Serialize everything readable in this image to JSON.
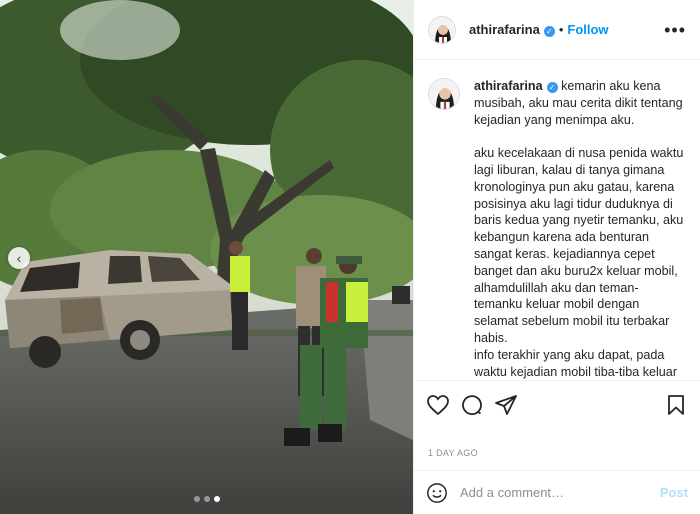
{
  "post": {
    "username": "athirafarina",
    "follow_label": "Follow",
    "bullet": "•",
    "more_label": "•••",
    "verified_mark": "✓",
    "timestamp": "1 DAY AGO",
    "carousel": {
      "count": 3,
      "active_index": 2,
      "prev_icon": "chevron-left-icon",
      "prev_glyph": "‹"
    }
  },
  "caption": {
    "username": "athirafarina",
    "paragraph1": "kemarin aku kena musibah, aku mau cerita dikit tentang kejadian yang menimpa aku.",
    "paragraph2": "aku kecelakaan di nusa penida waktu lagi liburan, kalau di tanya gimana kronologinya pun aku gatau, karena posisinya aku lagi tidur duduknya di baris kedua yang nyetir temanku, aku kebangun karena ada benturan sangat keras. kejadiannya cepet banget dan aku buru2x keluar mobil, alhamdulillah aku dan teman-temanku keluar mobil dengan selamat sebelum mobil itu terbakar habis.",
    "paragraph3": "info terakhir yang aku dapat, pada waktu kejadian mobil tiba-tiba keluar asap saat jalan turunan dan ga bisa di kendalikan, lalu mobil menabrak ke pohon."
  },
  "actions": {
    "icons": [
      "heart-icon",
      "comment-icon",
      "share-icon",
      "bookmark-icon"
    ]
  },
  "comment_box": {
    "placeholder": "Add a comment…",
    "post_label": "Post",
    "emoji_icon": "smiley-icon"
  },
  "colors": {
    "link_blue": "#0095f6",
    "verified_blue": "#3897f0",
    "post_disabled": "#b2dffc",
    "muted": "#8e8e8e",
    "border": "#efefef"
  }
}
